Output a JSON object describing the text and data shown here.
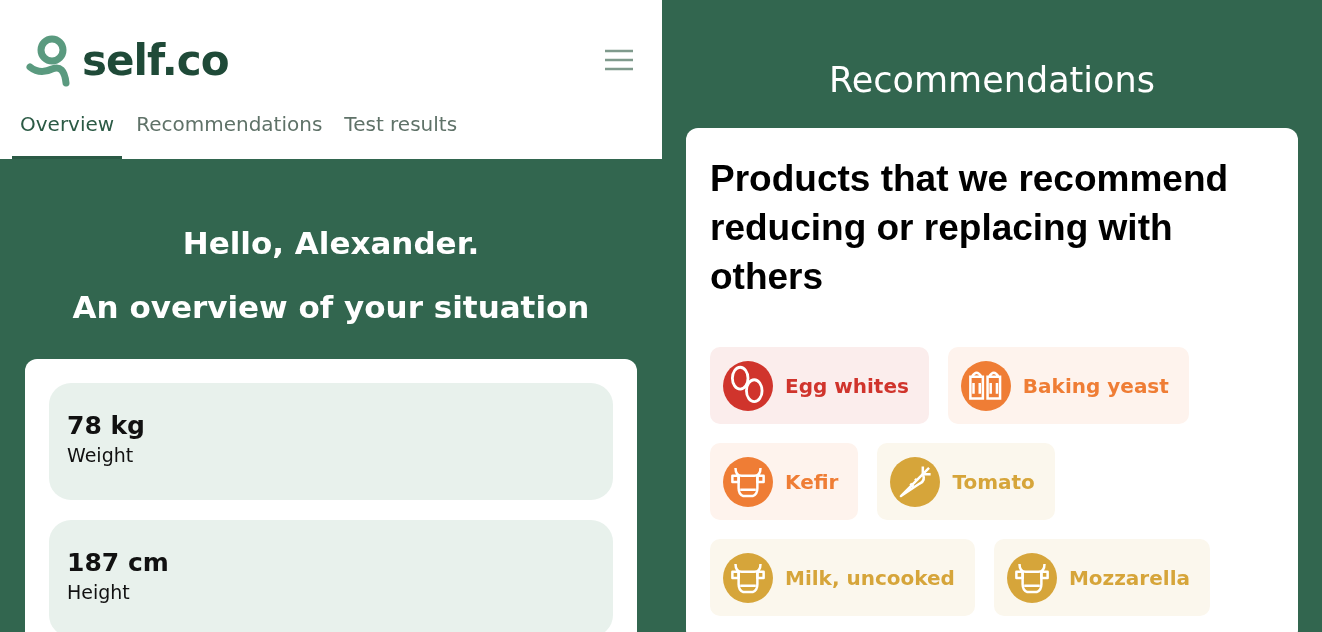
{
  "header": {
    "logo": "self.co"
  },
  "tabs": [
    {
      "label": "Overview",
      "selected": true
    },
    {
      "label": "Recommendations",
      "selected": false
    },
    {
      "label": "Test results",
      "selected": false
    }
  ],
  "overview": {
    "greeting": "Hello, Alexander.",
    "subtitle": "An overview of your situation",
    "stats": [
      {
        "value": "78 kg",
        "label": "Weight"
      },
      {
        "value": "187 cm",
        "label": "Height"
      }
    ]
  },
  "recommendations": {
    "title": "Recommendations",
    "heading": "Products that we recommend reducing or replacing with others",
    "products": [
      {
        "name": "Egg whites",
        "kind": "eggs",
        "color": "#d0342c"
      },
      {
        "name": "Baking yeast",
        "kind": "shakers",
        "color": "#ef7d35"
      },
      {
        "name": "Kefir",
        "kind": "cow",
        "color": "#ef7d35"
      },
      {
        "name": "Tomato",
        "kind": "carrot",
        "color": "#d6a53a"
      },
      {
        "name": "Milk, uncooked",
        "kind": "cow",
        "color": "#d6a53a"
      },
      {
        "name": "Mozzarella",
        "kind": "cow",
        "color": "#d6a53a"
      }
    ]
  }
}
